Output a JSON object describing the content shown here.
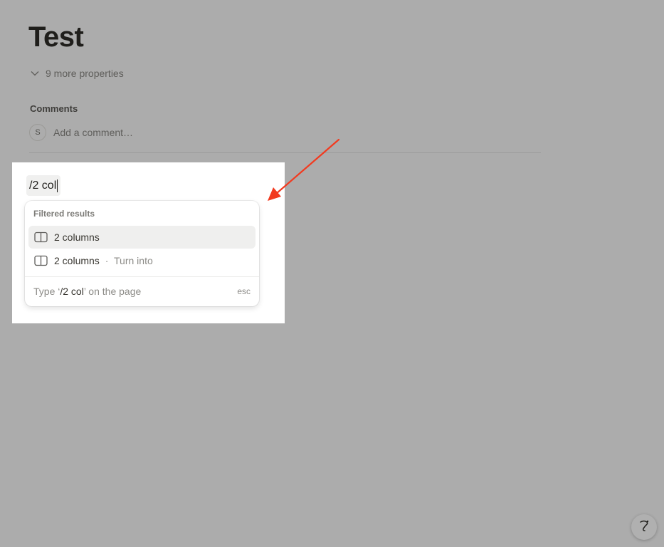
{
  "page": {
    "title": "Test",
    "properties_toggle": "9 more properties"
  },
  "comments": {
    "heading": "Comments",
    "avatar_initial": "S",
    "placeholder": "Add a comment…"
  },
  "editor": {
    "slash_text": "/2 col"
  },
  "menu": {
    "header": "Filtered results",
    "items": [
      {
        "label": "2 columns",
        "suffix": "",
        "icon": "columns-icon",
        "selected": true
      },
      {
        "label": "2 columns",
        "separator": "·",
        "suffix": "Turn into",
        "icon": "columns-icon",
        "selected": false
      }
    ],
    "footer_prefix": "Type ‘",
    "footer_query": "/2 col",
    "footer_suffix": "’ on the page",
    "footer_hint": "esc"
  },
  "annotation": {
    "arrow_color": "#f23a1f"
  },
  "colors": {
    "overlay": "#acacac",
    "selected_row": "#efefee"
  }
}
